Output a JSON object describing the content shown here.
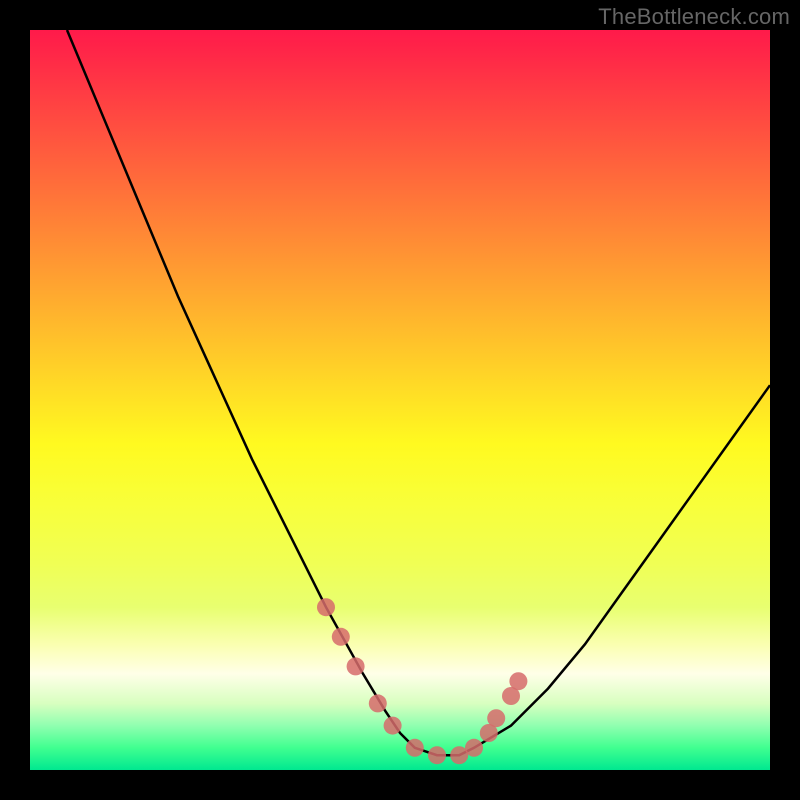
{
  "watermark": "TheBottleneck.com",
  "chart_data": {
    "type": "line",
    "title": "",
    "xlabel": "",
    "ylabel": "",
    "xlim": [
      0,
      100
    ],
    "ylim": [
      0,
      100
    ],
    "series": [
      {
        "name": "curve",
        "x": [
          5,
          10,
          15,
          20,
          25,
          30,
          35,
          40,
          45,
          48,
          50,
          52,
          55,
          58,
          60,
          65,
          70,
          75,
          80,
          85,
          90,
          95,
          100
        ],
        "y": [
          100,
          88,
          76,
          64,
          53,
          42,
          32,
          22,
          13,
          8,
          5,
          3,
          2,
          2,
          3,
          6,
          11,
          17,
          24,
          31,
          38,
          45,
          52
        ]
      }
    ],
    "markers": {
      "name": "points",
      "color": "#d66b6b",
      "x": [
        40,
        42,
        44,
        47,
        49,
        52,
        55,
        58,
        60,
        62,
        63,
        65,
        66
      ],
      "y": [
        22,
        18,
        14,
        9,
        6,
        3,
        2,
        2,
        3,
        5,
        7,
        10,
        12
      ]
    }
  }
}
